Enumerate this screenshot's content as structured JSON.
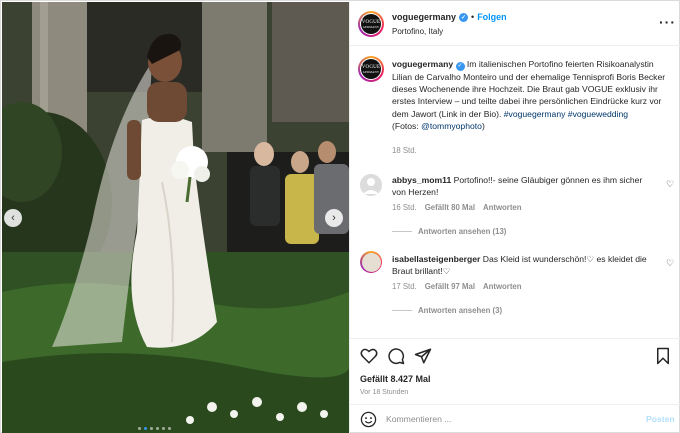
{
  "post": {
    "account": "voguegermany",
    "follow_label": "Folgen",
    "separator": "•",
    "location": "Portofino, Italy",
    "logo_text": "VOGUE",
    "logo_sub": "GERMANY",
    "caption_text": "Im italienischen Portofino feierten Risikoanalystin Lilian de Carvalho Monteiro und der ehemalige Tennisprofi Boris Becker dieses Wochenende ihre Hochzeit. Die Braut gab VOGUE exklusiv ihr erstes Interview – und teilte dabei ihre persönlichen Eindrücke kurz vor dem Jawort (Link in der Bio).",
    "hashtag_1": "#voguegermany",
    "hashtag_2": "#voguewedding",
    "photo_credit_prefix": "(Fotos: ",
    "photo_credit_handle": "@tommyophoto",
    "photo_credit_suffix": ")",
    "caption_time": "18 Std."
  },
  "comments": [
    {
      "user": "abbys_mom11",
      "text": "Portofino!!- seine Gläubiger gönnen es ihm sicher von Herzen!",
      "time": "16 Std.",
      "likes": "Gefällt 80 Mal",
      "reply_label": "Antworten",
      "view_replies": "Antworten ansehen (13)"
    },
    {
      "user": "isabellasteigenberger",
      "text": "Das Kleid ist wunderschön!♡ es kleidet die Braut brillant!♡",
      "time": "17 Std.",
      "likes": "Gefällt 97 Mal",
      "reply_label": "Antworten",
      "view_replies": "Antworten ansehen (3)"
    }
  ],
  "actions": {
    "like_count": "Gefällt 8.427 Mal",
    "posted": "Vor 18 Stunden"
  },
  "comment_box": {
    "placeholder": "Kommentieren ...",
    "post_label": "Posten"
  },
  "icons": {
    "like": "heart-icon",
    "comment": "comment-icon",
    "share": "send-icon",
    "save": "bookmark-icon",
    "emoji": "smiley-icon",
    "more": "more-options-icon",
    "prev": "chevron-left-icon",
    "next": "chevron-right-icon"
  },
  "colors": {
    "link_blue": "#0095f6",
    "hashtag": "#00376b",
    "muted": "#8e8e8e"
  },
  "carousel": {
    "total": 6,
    "active_index": 1
  }
}
